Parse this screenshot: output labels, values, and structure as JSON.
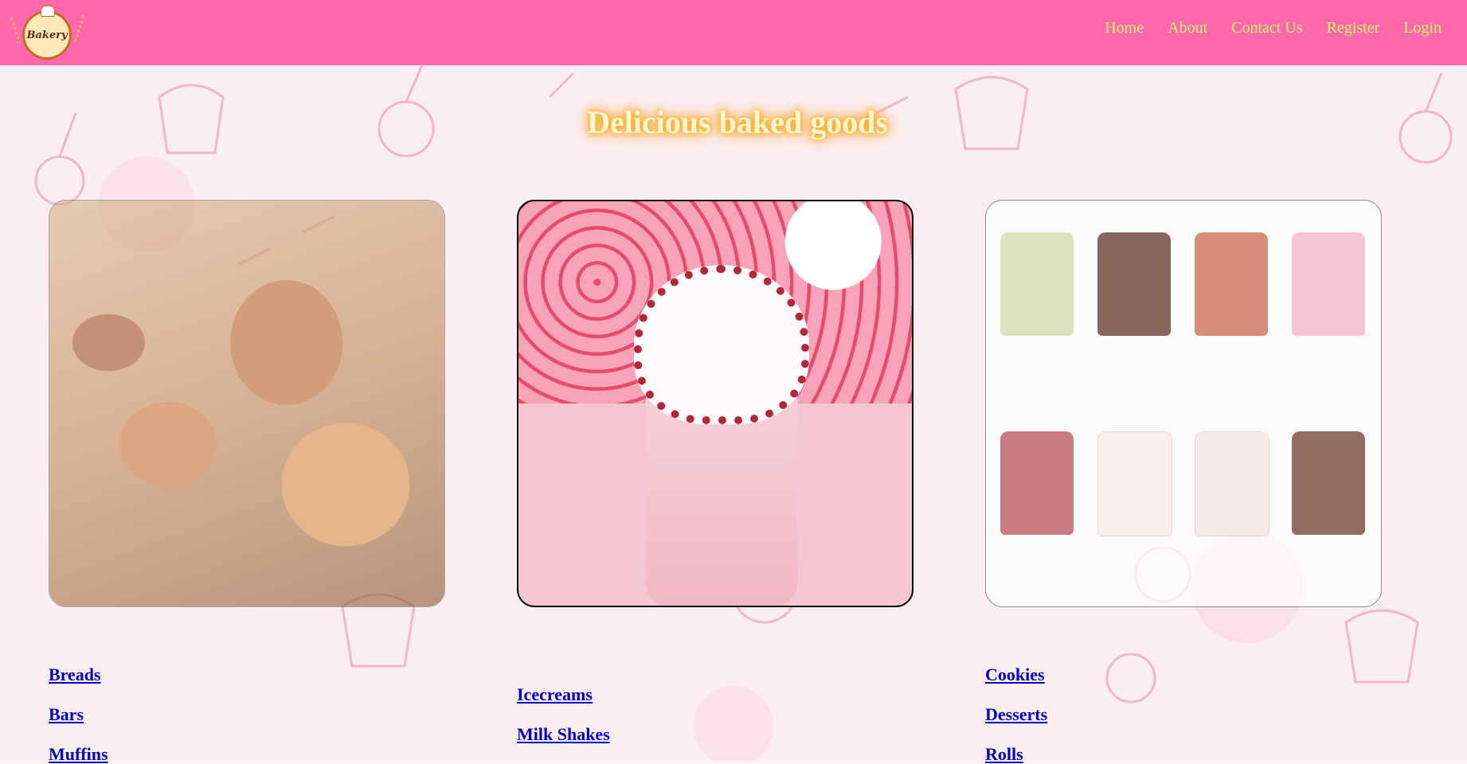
{
  "navbar": {
    "logo_text": "Bakery",
    "links": [
      "Home",
      "About",
      "Contact Us",
      "Register",
      "Login"
    ],
    "background": "#ff69ac",
    "link_color": "#c8f56a"
  },
  "main": {
    "headline": "Delicious baked goods",
    "cards": [
      {
        "name": "breads-pastries-image"
      },
      {
        "name": "milkshake-image"
      },
      {
        "name": "cakes-image"
      }
    ],
    "columns": [
      [
        "Breads",
        "Bars",
        "Muffins"
      ],
      [
        "Icecreams",
        "Milk Shakes"
      ],
      [
        "Cookies",
        "Desserts",
        "Rolls"
      ]
    ]
  },
  "colors": {
    "link": "#0000cc",
    "headline_glow": "#ff8a00"
  }
}
